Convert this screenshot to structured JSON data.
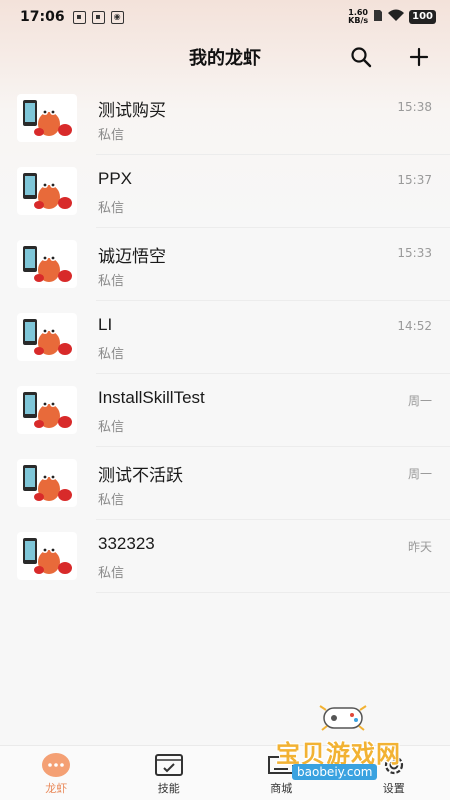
{
  "status_bar": {
    "time": "17:06",
    "net_speed_value": "1.60",
    "net_speed_unit": "KB/s",
    "battery": "100"
  },
  "header": {
    "title": "我的龙虾"
  },
  "chats": [
    {
      "name": "测试购买",
      "sub": "私信",
      "time": "15:38"
    },
    {
      "name": "PPX",
      "sub": "私信",
      "time": "15:37"
    },
    {
      "name": "诚迈悟空",
      "sub": "私信",
      "time": "15:33"
    },
    {
      "name": "LI",
      "sub": "私信",
      "time": "14:52"
    },
    {
      "name": "InstallSkillTest",
      "sub": "私信",
      "time": "周一"
    },
    {
      "name": "测试不活跃",
      "sub": "私信",
      "time": "周一"
    },
    {
      "name": "332323",
      "sub": "私信",
      "time": "昨天"
    }
  ],
  "bottom_nav": {
    "items": [
      {
        "label": "龙虾",
        "icon": "chat-bubble-icon",
        "active": true
      },
      {
        "label": "技能",
        "icon": "skill-board-icon",
        "active": false
      },
      {
        "label": "商城",
        "icon": "store-icon",
        "active": false
      },
      {
        "label": "设置",
        "icon": "gear-icon",
        "active": false
      }
    ]
  },
  "watermark": {
    "text": "宝贝游戏网",
    "url": "baobeiy.com"
  },
  "colors": {
    "accent": "#e98a5b",
    "header_gradient_top": "#f3e2da"
  }
}
